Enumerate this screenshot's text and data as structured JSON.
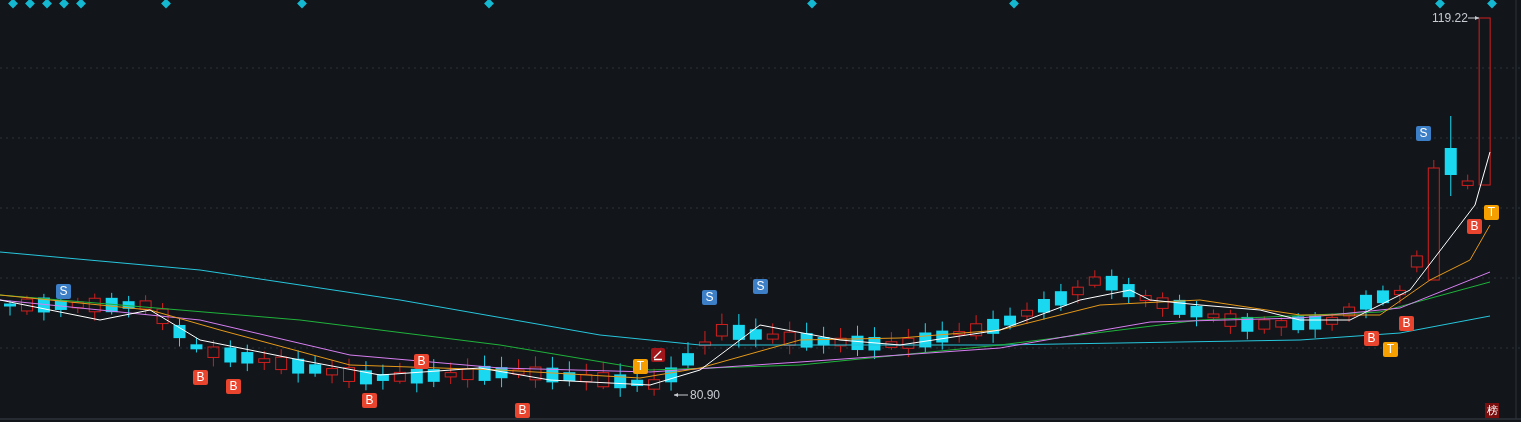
{
  "chart": {
    "high_label": "119.22",
    "low_label": "80.90",
    "corner_badge": "榜",
    "signals": [
      {
        "kind": "sell",
        "label": "S"
      },
      {
        "kind": "sell",
        "label": "S"
      },
      {
        "kind": "sell",
        "label": "S"
      },
      {
        "kind": "sell",
        "label": "S"
      },
      {
        "kind": "buy",
        "label": "B"
      },
      {
        "kind": "buy",
        "label": "B"
      },
      {
        "kind": "buy",
        "label": "B"
      },
      {
        "kind": "buy",
        "label": "B"
      },
      {
        "kind": "buy",
        "label": "B"
      },
      {
        "kind": "buy",
        "label": "B"
      },
      {
        "kind": "buy",
        "label": "B"
      },
      {
        "kind": "buy",
        "label": "B"
      },
      {
        "kind": "take",
        "label": "T"
      },
      {
        "kind": "take",
        "label": "T"
      },
      {
        "kind": "take",
        "label": "T"
      }
    ]
  }
}
